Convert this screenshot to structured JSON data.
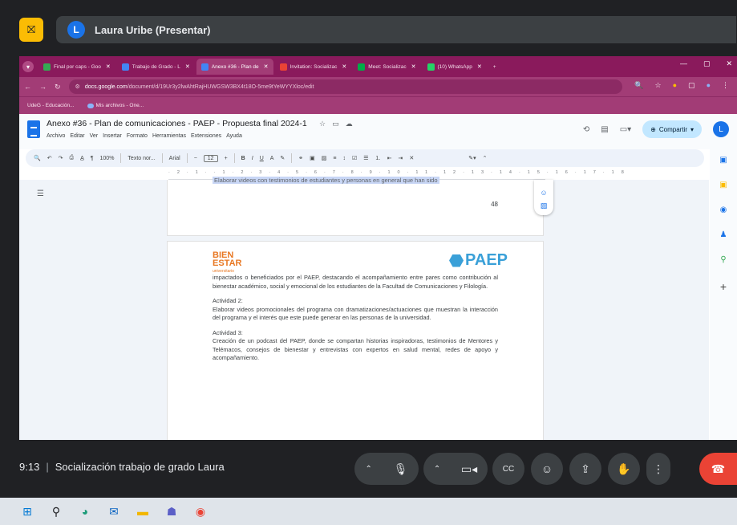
{
  "meet": {
    "presenter_initial": "L",
    "presenter_label": "Laura Uribe (Presentar)",
    "time": "9:13",
    "separator": "|",
    "meeting_name": "Socialización trabajo de grado Laura"
  },
  "chrome": {
    "tabs": [
      {
        "label": "Final por caps - Goo",
        "color": "#34a853",
        "active": false
      },
      {
        "label": "Trabajo de Grado - L",
        "color": "#4285f4",
        "active": false
      },
      {
        "label": "Anexo #36 - Plan de",
        "color": "#4285f4",
        "active": true
      },
      {
        "label": "Invitation: Socializac",
        "color": "#ea4335",
        "active": false
      },
      {
        "label": "Meet: Socializac",
        "color": "#00ac47",
        "active": false
      },
      {
        "label": "(10) WhatsApp",
        "color": "#25d366",
        "active": false
      }
    ],
    "url_domain": "docs.google.com",
    "url_path": "/document/d/19Ur3y2lwAhtRajHUWGSW3BX4t18O-5me9tYeWYYXloc/edit",
    "bookmarks": [
      "UdeG - Educación...",
      "Mis archivos - One..."
    ]
  },
  "docs": {
    "title": "Anexo #36 - Plan de comunicaciones - PAEP - Propuesta final 2024-1",
    "menu": [
      "Archivo",
      "Editar",
      "Ver",
      "Insertar",
      "Formato",
      "Herramientas",
      "Extensiones",
      "Ayuda"
    ],
    "share_label": "Compartir",
    "user_initial": "L",
    "toolbar": {
      "zoom": "100%",
      "style": "Texto nor...",
      "font": "Arial",
      "font_size": "12"
    },
    "page_number": "48",
    "cut_text": "Elaborar videos con testimonios de estudiantes y personas en general que han sido",
    "logo_bien": [
      "BIEN",
      "ESTAR"
    ],
    "logo_bien_sub": "universitario",
    "logo_paep": "PAEP",
    "para1": "impactados o beneficiados por el PAEP, destacando el acompañamiento entre pares como contribución al bienestar académico, social y emocional de los estudiantes de la Facultad de Comunicaciones y Filología.",
    "act2_title": "Actividad 2:",
    "act2_text": "Elaborar videos promocionales del programa con dramatizaciones/actuaciones que muestran la interacción del programa y el interés que este puede generar en las personas de la universidad.",
    "act3_title": "Actividad 3:",
    "act3_text": "Creación de un podcast del PAEP, donde se compartan historias inspiradoras, testimonios de Mentores y Telémacos, consejos de bienestar y entrevistas con expertos en salud mental, redes de apoyo y acompañamiento."
  }
}
